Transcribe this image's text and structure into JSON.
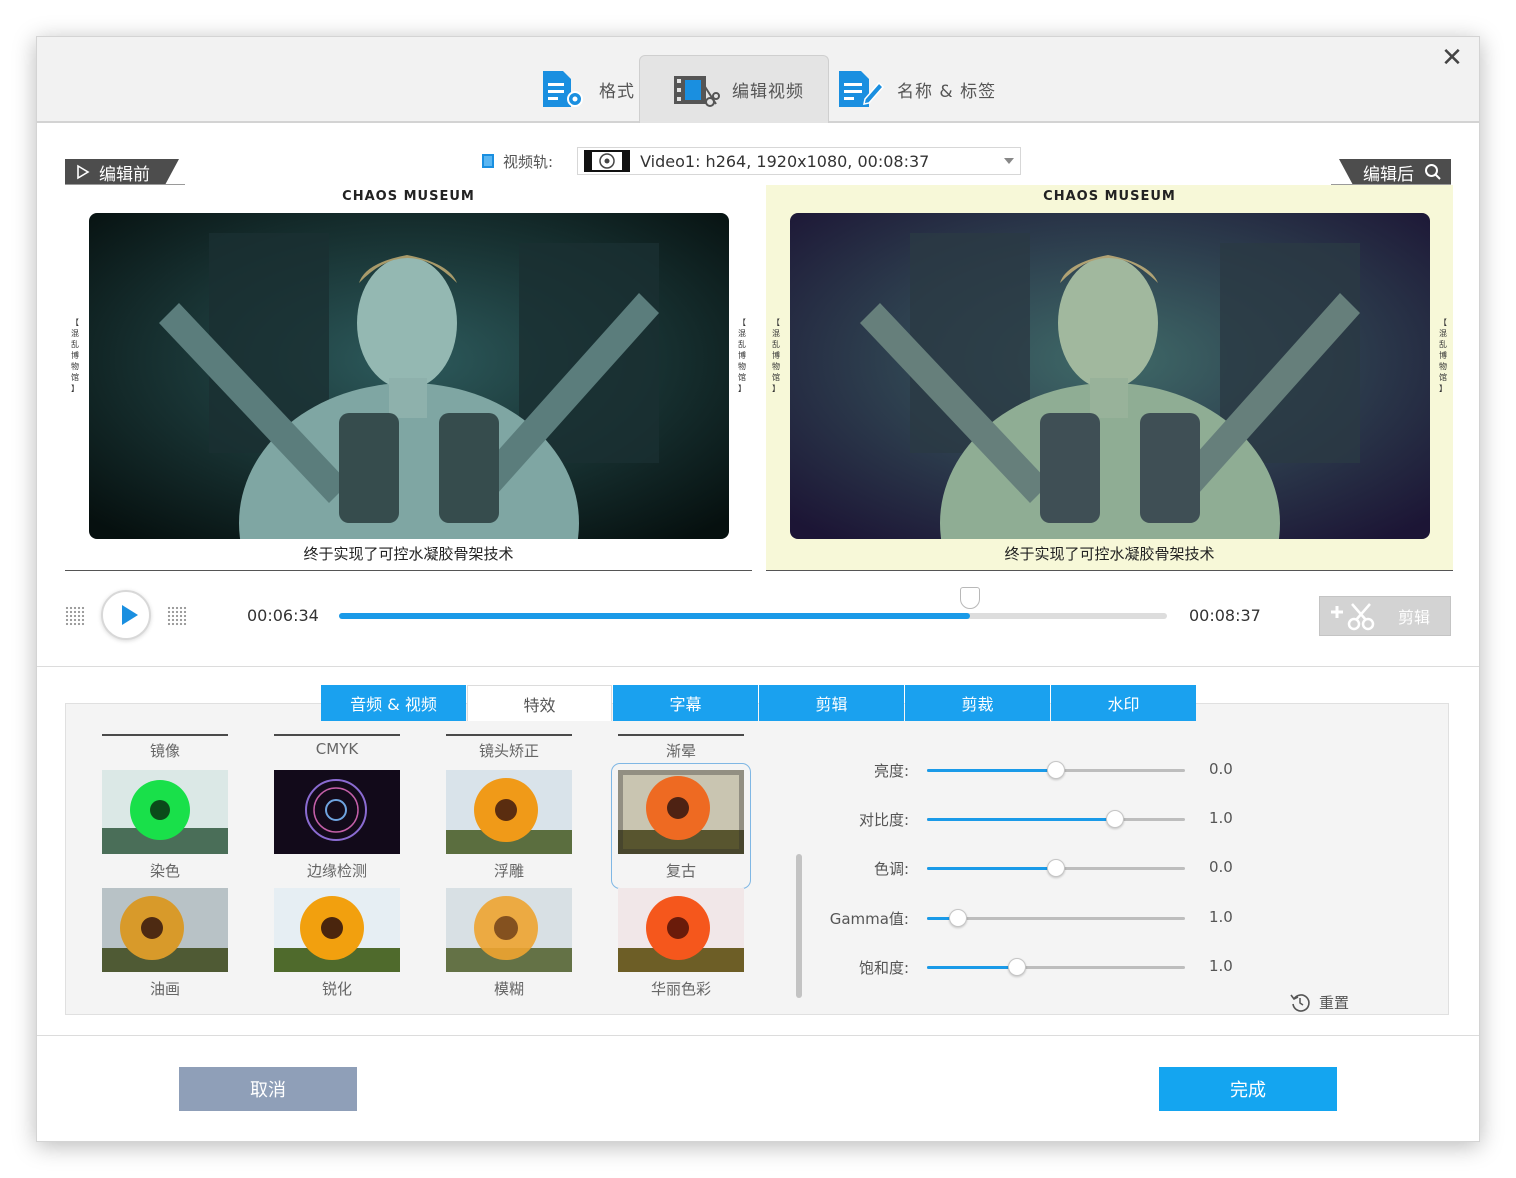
{
  "top_tabs": [
    {
      "label": "格式",
      "icon": "format-doc-gear-icon"
    },
    {
      "label": "编辑视频",
      "icon": "film-scissors-icon"
    },
    {
      "label": "名称 & 标签",
      "icon": "doc-pen-icon"
    }
  ],
  "active_top_tab": "编辑视频",
  "close_icon": "✕",
  "before_tag": "编辑前",
  "after_tag": "编辑后",
  "video_track": {
    "label": "视频轨:",
    "value": "Video1: h264, 1920x1080, 00:08:37"
  },
  "preview_before": {
    "title": "CHAOS MUSEUM",
    "caption": "终于实现了可控水凝胶骨架技术",
    "side_text": "【混乱博物馆】"
  },
  "preview_after": {
    "title": "CHAOS MUSEUM",
    "caption": "终于实现了可控水凝胶骨架技术",
    "side_text": "【混乱博物馆】"
  },
  "playback": {
    "current_time": "00:06:34",
    "total_time": "00:08:37",
    "progress": 0.762
  },
  "cut_button": {
    "label": "剪辑"
  },
  "effect_tabs": [
    "音频 & 视频",
    "特效",
    "字幕",
    "剪辑",
    "剪裁",
    "水印"
  ],
  "active_effect_tab": "特效",
  "effect_headers": [
    "镜像",
    "CMYK",
    "镜头矫正",
    "渐晕"
  ],
  "effects": [
    {
      "label": "染色",
      "selected": false
    },
    {
      "label": "边缘检测",
      "selected": false
    },
    {
      "label": "浮雕",
      "selected": false
    },
    {
      "label": "复古",
      "selected": true
    },
    {
      "label": "油画",
      "selected": false
    },
    {
      "label": "锐化",
      "selected": false
    },
    {
      "label": "模糊",
      "selected": false
    },
    {
      "label": "华丽色彩",
      "selected": false
    }
  ],
  "adjustments": [
    {
      "label": "亮度:",
      "value": "0.0",
      "level": 0.5
    },
    {
      "label": "对比度:",
      "value": "1.0",
      "level": 0.73
    },
    {
      "label": "色调:",
      "value": "0.0",
      "level": 0.5
    },
    {
      "label": "Gamma值:",
      "value": "1.0",
      "level": 0.12
    },
    {
      "label": "饱和度:",
      "value": "1.0",
      "level": 0.35
    }
  ],
  "reset_label": "重置",
  "cancel_label": "取消",
  "done_label": "完成",
  "colors": {
    "accent": "#1aa1ef",
    "cancel": "#8f9fb8",
    "after_bg": "#f7f8d8"
  }
}
